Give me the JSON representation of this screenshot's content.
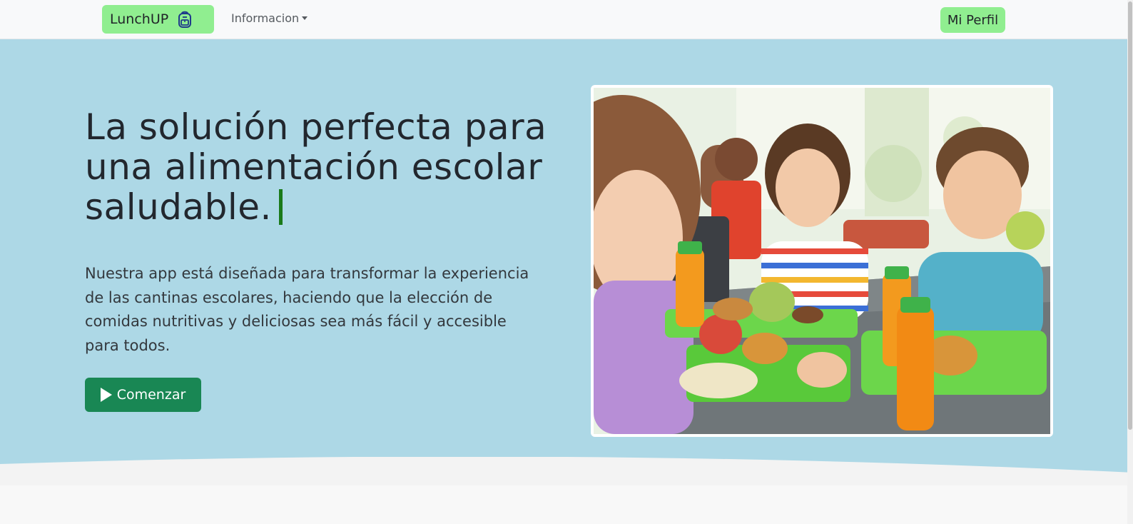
{
  "navbar": {
    "brand": "LunchUP",
    "brand_icon": "backpack-icon",
    "info_label": "Informacion",
    "profile_label": "Mi Perfil"
  },
  "hero": {
    "title": "La solución perfecta para una alimentación escolar saludable.",
    "description": "Nuestra app está diseñada para transformar la experiencia de las cantinas escolares, haciendo que la elección de comidas nutritivas y deliciosas sea más fácil y accesible para todos.",
    "cta_label": "Comenzar",
    "cta_icon": "play-icon"
  },
  "colors": {
    "navbar_bg": "#f8f9fa",
    "brand_bg": "#90ee90",
    "hero_bg": "#add8e6",
    "cta_bg": "#198754",
    "cursor": "#1a7a1a"
  }
}
